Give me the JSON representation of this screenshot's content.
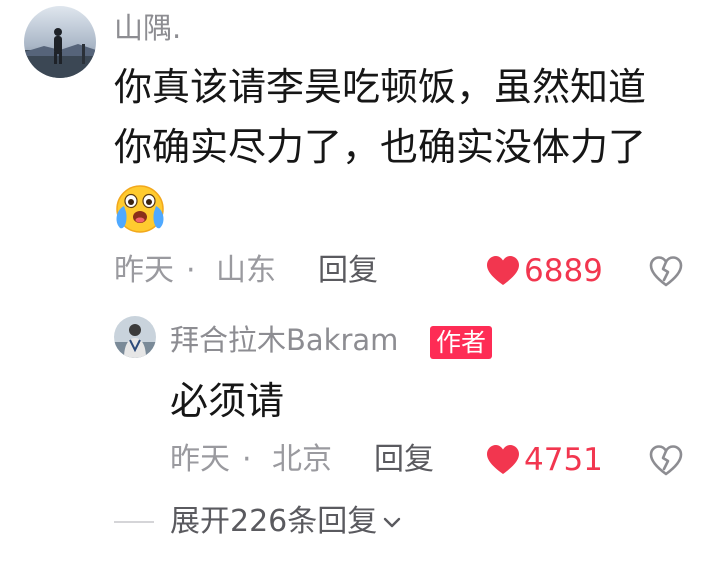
{
  "main_comment": {
    "username": "山隅.",
    "text_lines": [
      "你真该请李昊吃顿饭，虽然知道",
      "你确实尽力了，也确实没体力了"
    ],
    "emoji": "crying-laughing-emoji",
    "date": "昨天",
    "separator": "·",
    "location": "山东",
    "reply_label": "回复",
    "likes": "6889"
  },
  "reply_comment": {
    "username": "拜合拉木Bakram",
    "author_badge": "作者",
    "text": "必须请",
    "date": "昨天",
    "separator": "·",
    "location": "北京",
    "reply_label": "回复",
    "likes": "4751"
  },
  "expand": {
    "label": "展开226条回复"
  },
  "colors": {
    "like_red": "#f2364f",
    "badge_red": "#fe2c55",
    "meta_gray": "#9a9a9f",
    "username_gray": "#8d8d92"
  },
  "icons": [
    "heart-icon",
    "dislike-heart-icon",
    "chevron-down-icon"
  ]
}
